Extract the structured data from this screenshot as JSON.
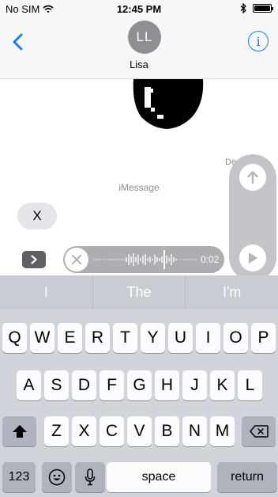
{
  "status_bar": {
    "carrier": "No SIM",
    "time": "12:45 PM"
  },
  "header": {
    "contact_initials": "LL",
    "contact_name": "Lisa"
  },
  "conversation": {
    "delivered_label": "De",
    "service_label": "iMessage",
    "received_message": "X"
  },
  "audio": {
    "duration": "0:02"
  },
  "predictive": [
    "I",
    "The",
    "I'm"
  ],
  "keyboard": {
    "row1": [
      "Q",
      "W",
      "E",
      "R",
      "T",
      "Y",
      "U",
      "I",
      "O",
      "P"
    ],
    "row2": [
      "A",
      "S",
      "D",
      "F",
      "G",
      "H",
      "J",
      "K",
      "L"
    ],
    "row3": [
      "Z",
      "X",
      "C",
      "V",
      "B",
      "N",
      "M"
    ],
    "numbers_label": "123",
    "space_label": "space",
    "return_label": "return"
  },
  "colors": {
    "accent": "#147efb",
    "bubble_gray": "#e5e5ea",
    "keyboard_bg": "#d1d4da"
  },
  "icons": [
    "wifi-icon",
    "bluetooth-icon",
    "battery-icon",
    "chevron-left-icon",
    "info-icon",
    "apps-icon",
    "close-icon",
    "arrow-up-icon",
    "play-icon",
    "shift-icon",
    "emoji-icon",
    "microphone-icon",
    "delete-icon"
  ]
}
